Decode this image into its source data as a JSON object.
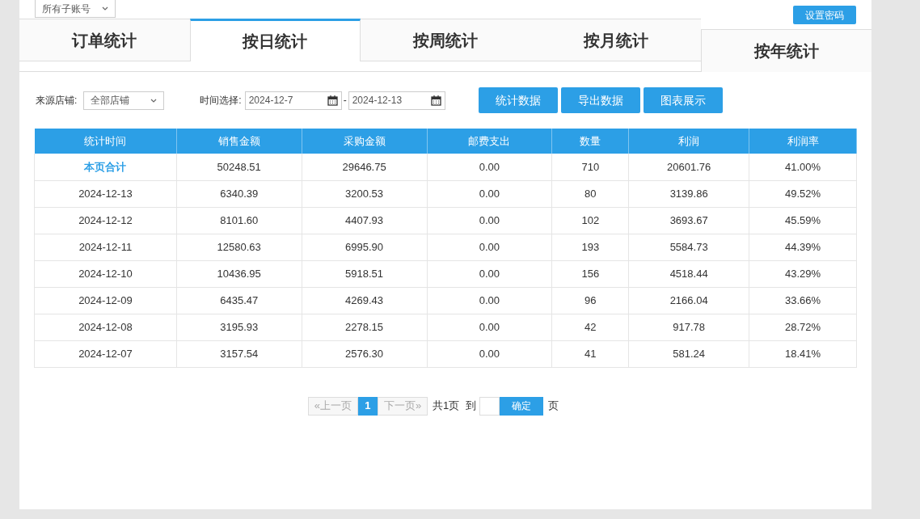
{
  "account_select": {
    "value": "所有子账号"
  },
  "settings_button": "设置密码",
  "tabs": [
    {
      "label": "订单统计",
      "selected": false
    },
    {
      "label": "按日统计",
      "selected": true
    },
    {
      "label": "按周统计",
      "selected": false
    },
    {
      "label": "按月统计",
      "selected": false
    },
    {
      "label": "按年统计",
      "selected": false,
      "kind": "dropped"
    }
  ],
  "filters": {
    "shop_label": "来源店铺:",
    "shop_value": "全部店铺",
    "time_label": "时间选择:",
    "date_from": "2024-12-7",
    "separator": "-",
    "date_to": "2024-12-13"
  },
  "actions": [
    "统计数据",
    "导出数据",
    "图表展示"
  ],
  "table": {
    "columns": [
      "统计时间",
      "销售金额",
      "采购金额",
      "邮费支出",
      "数量",
      "利润",
      "利润率"
    ],
    "rows": [
      {
        "kind": "total",
        "cells": [
          "本页合计",
          "50248.51",
          "29646.75",
          "0.00",
          "710",
          "20601.76",
          "41.00%"
        ]
      },
      {
        "kind": "day",
        "cells": [
          "2024-12-13",
          "6340.39",
          "3200.53",
          "0.00",
          "80",
          "3139.86",
          "49.52%"
        ]
      },
      {
        "kind": "day",
        "cells": [
          "2024-12-12",
          "8101.60",
          "4407.93",
          "0.00",
          "102",
          "3693.67",
          "45.59%"
        ]
      },
      {
        "kind": "day",
        "cells": [
          "2024-12-11",
          "12580.63",
          "6995.90",
          "0.00",
          "193",
          "5584.73",
          "44.39%"
        ]
      },
      {
        "kind": "day",
        "cells": [
          "2024-12-10",
          "10436.95",
          "5918.51",
          "0.00",
          "156",
          "4518.44",
          "43.29%"
        ]
      },
      {
        "kind": "day",
        "cells": [
          "2024-12-09",
          "6435.47",
          "4269.43",
          "0.00",
          "96",
          "2166.04",
          "33.66%"
        ]
      },
      {
        "kind": "day",
        "cells": [
          "2024-12-08",
          "3195.93",
          "2278.15",
          "0.00",
          "42",
          "917.78",
          "28.72%"
        ]
      },
      {
        "kind": "day",
        "cells": [
          "2024-12-07",
          "3157.54",
          "2576.30",
          "0.00",
          "41",
          "581.24",
          "18.41%"
        ]
      }
    ]
  },
  "pagination": {
    "prev": "«上一页",
    "pages": [
      {
        "label": "1",
        "selected": true
      }
    ],
    "next": "下一页»",
    "total": "共1页",
    "goto_label": "到",
    "confirm": "确定",
    "page_suffix": "页"
  }
}
